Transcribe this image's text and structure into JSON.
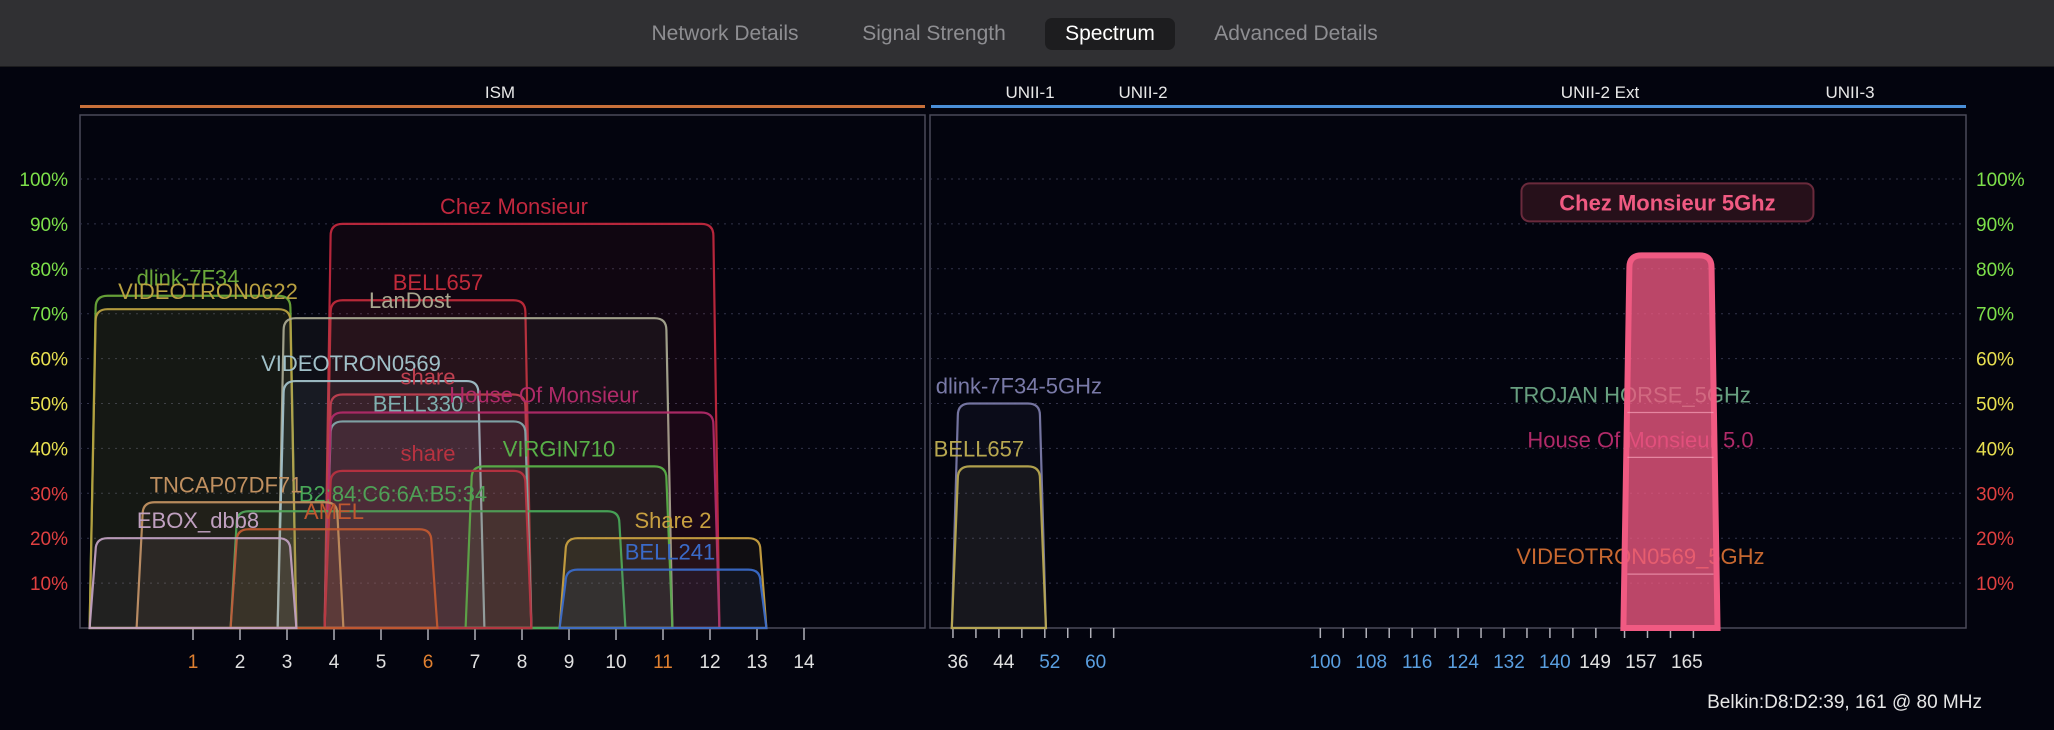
{
  "tabs": [
    {
      "label": "Network Details",
      "active": false
    },
    {
      "label": "Signal Strength",
      "active": false
    },
    {
      "label": "Spectrum",
      "active": true
    },
    {
      "label": "Advanced Details",
      "active": false
    }
  ],
  "footer": "Belkin:D8:D2:39, 161 @ 80 MHz",
  "colors": {
    "background": "#03040e",
    "ism_band": "#c8703a",
    "unii_band": "#4a8fd8",
    "selected_network": "#f05a82",
    "tick_label_24": "#e0e0e0",
    "tick_label_dfs": "#5a9fe0",
    "tick_label_overlap": "#e08030"
  },
  "chart_data": {
    "type": "area",
    "ylabel": "",
    "ylim": [
      0,
      100
    ],
    "yticks": [
      "10%",
      "20%",
      "30%",
      "40%",
      "50%",
      "60%",
      "70%",
      "80%",
      "90%",
      "100%"
    ],
    "ytick_values": [
      10,
      20,
      30,
      40,
      50,
      60,
      70,
      80,
      90,
      100
    ],
    "band_labels": [
      {
        "label": "ISM",
        "panel": "2.4GHz"
      },
      {
        "label": "UNII-1",
        "panel": "5GHz"
      },
      {
        "label": "UNII-2",
        "panel": "5GHz"
      },
      {
        "label": "UNII-2 Ext",
        "panel": "5GHz"
      },
      {
        "label": "UNII-3",
        "panel": "5GHz"
      }
    ],
    "channels_24": [
      {
        "label": "1",
        "ch": 1,
        "color": "#e08030"
      },
      {
        "label": "2",
        "ch": 2,
        "color": "#e0e0e0"
      },
      {
        "label": "3",
        "ch": 3,
        "color": "#e0e0e0"
      },
      {
        "label": "4",
        "ch": 4,
        "color": "#e0e0e0"
      },
      {
        "label": "5",
        "ch": 5,
        "color": "#e0e0e0"
      },
      {
        "label": "6",
        "ch": 6,
        "color": "#e08030"
      },
      {
        "label": "7",
        "ch": 7,
        "color": "#e0e0e0"
      },
      {
        "label": "8",
        "ch": 8,
        "color": "#e0e0e0"
      },
      {
        "label": "9",
        "ch": 9,
        "color": "#e0e0e0"
      },
      {
        "label": "10",
        "ch": 10,
        "color": "#e0e0e0"
      },
      {
        "label": "11",
        "ch": 11,
        "color": "#e08030"
      },
      {
        "label": "12",
        "ch": 12,
        "color": "#e0e0e0"
      },
      {
        "label": "13",
        "ch": 13,
        "color": "#e0e0e0"
      },
      {
        "label": "14",
        "ch": 14,
        "color": "#e0e0e0"
      }
    ],
    "channels_5": [
      {
        "label": "36",
        "ch": 40,
        "color": "#e0e0e0"
      },
      {
        "label": "44",
        "ch": 48,
        "color": "#e0e0e0"
      },
      {
        "label": "52",
        "ch": 56,
        "color": "#5a9fe0"
      },
      {
        "label": "60",
        "ch": 64,
        "color": "#5a9fe0"
      },
      {
        "label": "100",
        "ch": 104,
        "color": "#5a9fe0"
      },
      {
        "label": "108",
        "ch": 112,
        "color": "#5a9fe0"
      },
      {
        "label": "116",
        "ch": 120,
        "color": "#5a9fe0"
      },
      {
        "label": "124",
        "ch": 128,
        "color": "#5a9fe0"
      },
      {
        "label": "132",
        "ch": 136,
        "color": "#5a9fe0"
      },
      {
        "label": "140",
        "ch": 144,
        "color": "#5a9fe0"
      },
      {
        "label": "149",
        "ch": 151,
        "color": "#e0e0e0"
      },
      {
        "label": "157",
        "ch": 159,
        "color": "#e0e0e0"
      },
      {
        "label": "165",
        "ch": 167,
        "color": "#e0e0e0"
      }
    ],
    "series_24": [
      {
        "name": "Chez Monsieur",
        "center": 8,
        "width": 8,
        "strength": 90,
        "color": "#c0283e"
      },
      {
        "name": "dlink-7F34",
        "center": 1,
        "width": 4,
        "strength": 74,
        "color": "#6aa83a"
      },
      {
        "name": "VIDEOTRON0622",
        "center": 1,
        "width": 4,
        "strength": 71,
        "color": "#b8a040"
      },
      {
        "name": "BELL657",
        "center": 6,
        "width": 4,
        "strength": 73,
        "color": "#c02a3a"
      },
      {
        "name": "LanDost",
        "center": 7,
        "width": 8,
        "strength": 69,
        "color": "#a8a890"
      },
      {
        "name": "VIDEOTRON0569",
        "center": 5,
        "width": 4,
        "strength": 55,
        "color": "#a0c0c8"
      },
      {
        "name": "share",
        "center": 6,
        "width": 4,
        "strength": 52,
        "color": "#c04050"
      },
      {
        "name": "BELL330",
        "center": 6,
        "width": 4,
        "strength": 46,
        "color": "#80b0b0"
      },
      {
        "name": "House Of Monsieur",
        "center": 8,
        "width": 8,
        "strength": 48,
        "color": "#b02a68"
      },
      {
        "name": "VIRGIN710",
        "center": 9,
        "width": 4,
        "strength": 36,
        "color": "#58b048"
      },
      {
        "name": "B2:84:C6:6A:B5:34",
        "center": 6,
        "width": 8,
        "strength": 26,
        "color": "#48a858"
      },
      {
        "name": "share",
        "center": 6,
        "width": 4,
        "strength": 35,
        "color": "#b83240"
      },
      {
        "name": "TNCAP07DF71",
        "center": 2,
        "width": 4,
        "strength": 28,
        "color": "#c09060"
      },
      {
        "name": "AMEL",
        "center": 4,
        "width": 4,
        "strength": 22,
        "color": "#c05830"
      },
      {
        "name": "EBOX_dbb8",
        "center": 1,
        "width": 4,
        "strength": 20,
        "color": "#c0a0c0"
      },
      {
        "name": "Share 2",
        "center": 11,
        "width": 4,
        "strength": 20,
        "color": "#c8a040"
      },
      {
        "name": "BELL241",
        "center": 11,
        "width": 4,
        "strength": 13,
        "color": "#3a6ac8"
      }
    ],
    "series_5": [
      {
        "name": "Chez Monsieur 5Ghz",
        "center": 161,
        "width": 16,
        "strength": 83,
        "color": "#f05a82",
        "selected": true
      },
      {
        "name": "dlink-7F34-5GHz",
        "center": 44,
        "width": 16,
        "strength": 50,
        "color": "#7a7aa8",
        "selected": false
      },
      {
        "name": "BELL657",
        "center": 44,
        "width": 16,
        "strength": 36,
        "color": "#b8a850",
        "selected": false
      },
      {
        "name": "TROJAN HORSE_5GHz",
        "center": 161,
        "width": 16,
        "strength": 48,
        "color": "#68a080",
        "selected": false
      },
      {
        "name": "House Of Monsieur 5.0",
        "center": 161,
        "width": 16,
        "strength": 38,
        "color": "#b02a68",
        "selected": false
      },
      {
        "name": "VIDEOTRON0569_5GHz",
        "center": 161,
        "width": 16,
        "strength": 12,
        "color": "#c86830",
        "selected": false
      }
    ]
  }
}
